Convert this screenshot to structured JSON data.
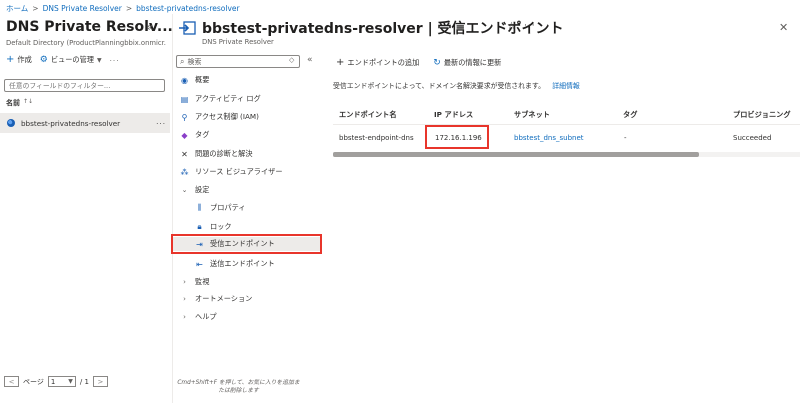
{
  "breadcrumb": [
    "ホーム",
    "DNS Private Resolver",
    "bbstest-privatedns-resolver"
  ],
  "left": {
    "title": "DNS Private Resolv...",
    "subtitle": "Default Directory (ProductPlanningbbix.onmicr...",
    "create_label": "作成",
    "view_label": "ビューの管理",
    "filter_placeholder": "任意のフィールドのフィルター...",
    "name_header": "名前",
    "sort_icon": "↑↓",
    "resource_name": "bbstest-privatedns-resolver",
    "pager_label": "ページ",
    "page_value": "1",
    "page_total": "/ 1"
  },
  "blade": {
    "title": "bbstest-privatedns-resolver | 受信エンドポイント",
    "subtitle": "DNS Private Resolver"
  },
  "menu": {
    "search_placeholder": "検索",
    "items": [
      {
        "label": "概要",
        "icon": "overview-icon"
      },
      {
        "label": "アクティビティ ログ",
        "icon": "activity-log-icon"
      },
      {
        "label": "アクセス制御 (IAM)",
        "icon": "iam-icon"
      },
      {
        "label": "タグ",
        "icon": "tag-icon"
      },
      {
        "label": "問題の診断と解決",
        "icon": "diagnose-icon"
      },
      {
        "label": "リソース ビジュアライザー",
        "icon": "visualizer-icon"
      },
      {
        "label": "設定",
        "icon": "chevron-down-icon"
      },
      {
        "label": "プロパティ",
        "icon": "properties-icon"
      },
      {
        "label": "ロック",
        "icon": "lock-icon"
      },
      {
        "label": "受信エンドポイント",
        "icon": "inbound-endpoint-icon"
      },
      {
        "label": "送信エンドポイント",
        "icon": "outbound-endpoint-icon"
      },
      {
        "label": "監視",
        "icon": "chevron-right-icon"
      },
      {
        "label": "オートメーション",
        "icon": "chevron-right-icon"
      },
      {
        "label": "ヘルプ",
        "icon": "chevron-right-icon"
      }
    ],
    "footer": "Cmd+Shift+F を押して、お気に入りを追加または削除します"
  },
  "content": {
    "add_label": "エンドポイントの追加",
    "refresh_label": "最新の情報に更新",
    "info": "受信エンドポイントによって、ドメイン名解決要求が受信されます。",
    "info_link": "詳細情報",
    "columns": [
      "エンドポイント名",
      "IP アドレス",
      "サブネット",
      "タグ",
      "プロビジョニング"
    ],
    "row": {
      "name": "bbstest-endpoint-dns",
      "ip": "172.16.1.196",
      "subnet": "bbstest_dns_subnet",
      "tags": "-",
      "state": "Succeeded"
    }
  },
  "colors": {
    "link": "#0f6cbd",
    "highlight": "#e8352b",
    "selected_bg": "#edebe9"
  }
}
